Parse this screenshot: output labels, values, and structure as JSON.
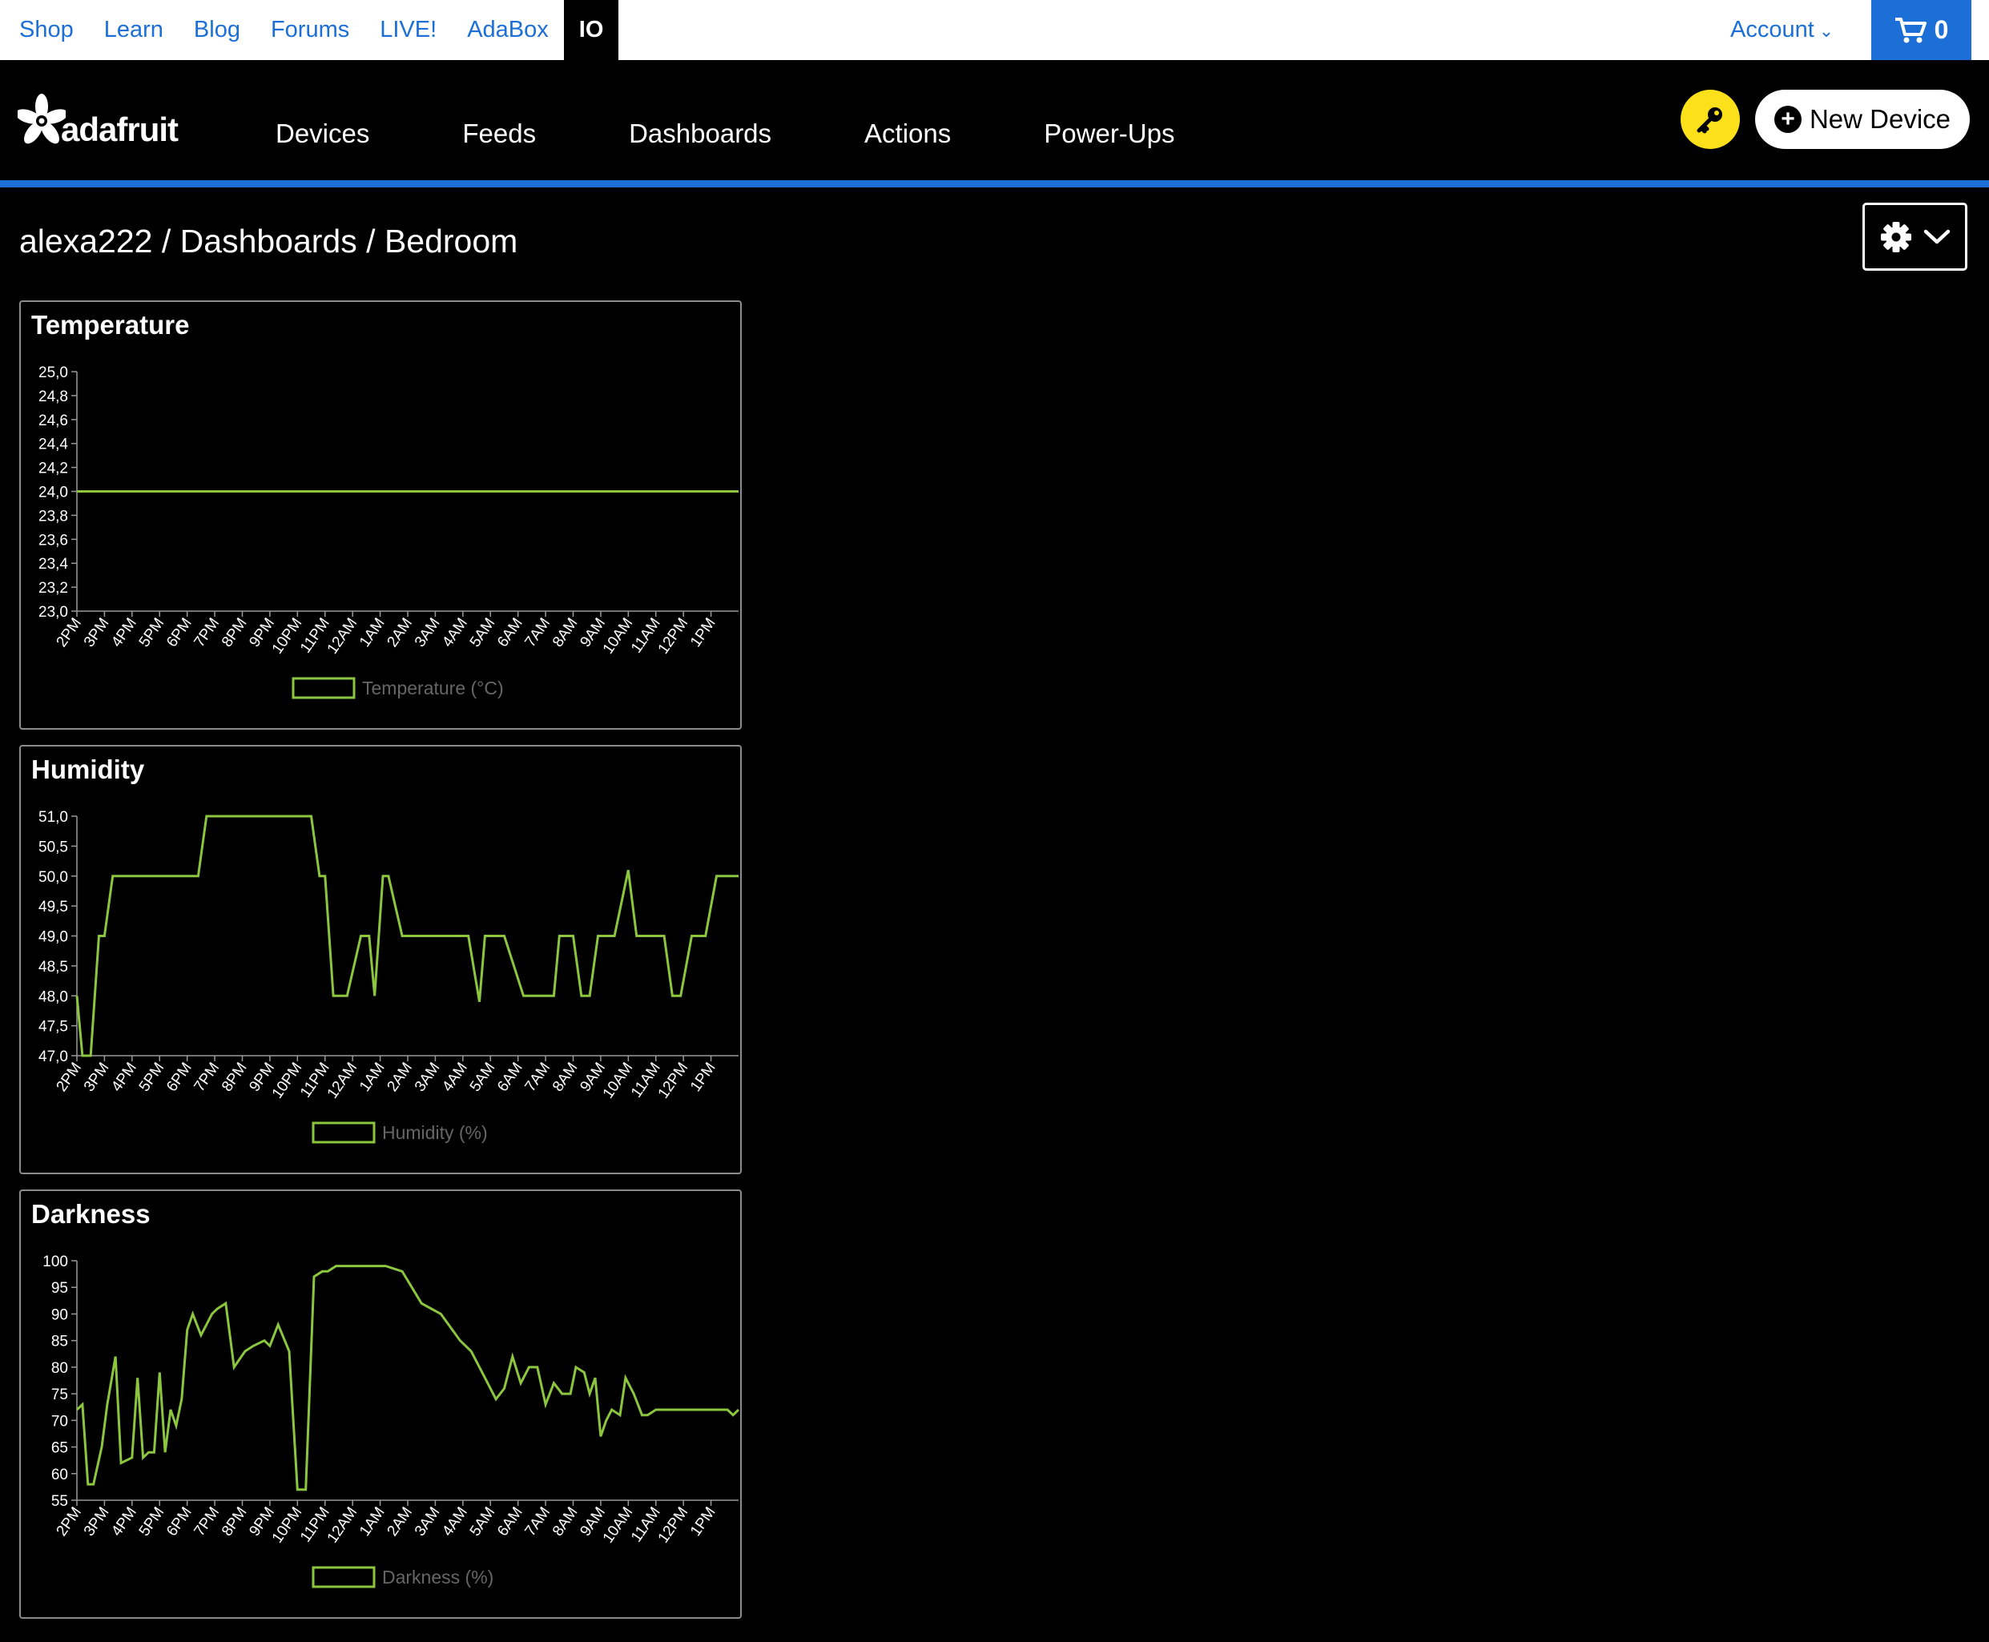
{
  "topbar": {
    "links": [
      "Shop",
      "Learn",
      "Blog",
      "Forums",
      "LIVE!",
      "AdaBox",
      "IO"
    ],
    "active": "IO",
    "account_label": "Account",
    "cart_count": "0"
  },
  "nav": {
    "logo_text": "adafruit",
    "links": [
      "Devices",
      "Feeds",
      "Dashboards",
      "Actions",
      "Power-Ups"
    ],
    "new_device_label": "New Device"
  },
  "breadcrumb": {
    "user": "alexa222",
    "section": "Dashboards",
    "page": "Bedroom",
    "separator": "/"
  },
  "colors": {
    "accent_blue": "#1c6fd6",
    "key_yellow": "#fce01a",
    "series_green": "#8cc63f",
    "legend_text": "#666666"
  },
  "chart_data": [
    {
      "type": "line",
      "title": "Temperature",
      "x_ticks": [
        "2PM",
        "3PM",
        "4PM",
        "5PM",
        "6PM",
        "7PM",
        "8PM",
        "9PM",
        "10PM",
        "11PM",
        "12AM",
        "1AM",
        "2AM",
        "3AM",
        "4AM",
        "5AM",
        "6AM",
        "7AM",
        "8AM",
        "9AM",
        "10AM",
        "11AM",
        "12PM",
        "1PM"
      ],
      "y_ticks": [
        "25,0",
        "24,8",
        "24,6",
        "24,4",
        "24,2",
        "24,0",
        "23,8",
        "23,6",
        "23,4",
        "23,2",
        "23,0"
      ],
      "ylim": [
        23,
        25
      ],
      "xlim": [
        0,
        24
      ],
      "series": [
        {
          "name": "Temperature (°C)",
          "x": [
            0,
            24
          ],
          "y": [
            24.0,
            24.0
          ]
        }
      ]
    },
    {
      "type": "line",
      "title": "Humidity",
      "x_ticks": [
        "2PM",
        "3PM",
        "4PM",
        "5PM",
        "6PM",
        "7PM",
        "8PM",
        "9PM",
        "10PM",
        "11PM",
        "12AM",
        "1AM",
        "2AM",
        "3AM",
        "4AM",
        "5AM",
        "6AM",
        "7AM",
        "8AM",
        "9AM",
        "10AM",
        "11AM",
        "12PM",
        "1PM"
      ],
      "y_ticks": [
        "51,0",
        "50,5",
        "50,0",
        "49,5",
        "49,0",
        "48,5",
        "48,0",
        "47,5",
        "47,0"
      ],
      "ylim": [
        47,
        51
      ],
      "xlim": [
        0,
        24
      ],
      "series": [
        {
          "name": "Humidity (%)",
          "x": [
            0,
            0.2,
            0.5,
            0.8,
            1.0,
            1.3,
            1.7,
            2.5,
            3.5,
            4.4,
            4.7,
            5.3,
            6.3,
            7.5,
            8.5,
            8.8,
            9.0,
            9.3,
            9.8,
            10.3,
            10.6,
            10.8,
            11.1,
            11.3,
            11.8,
            12.5,
            13.5,
            14.2,
            14.6,
            14.8,
            15.5,
            16.2,
            17.3,
            17.5,
            18.0,
            18.3,
            18.6,
            18.9,
            19.5,
            20.0,
            20.3,
            20.6,
            21.3,
            21.6,
            21.9,
            22.3,
            22.8,
            23.2,
            23.6,
            24.0
          ],
          "y": [
            48,
            47,
            47,
            49,
            49,
            50,
            50,
            50,
            50,
            50,
            51,
            51,
            51,
            51,
            51,
            50,
            50,
            48,
            48,
            49,
            49,
            48,
            50,
            50,
            49,
            49,
            49,
            49,
            47.9,
            49,
            49,
            48,
            48,
            49,
            49,
            48,
            48,
            49,
            49,
            50.1,
            49,
            49,
            49,
            48,
            48,
            49,
            49,
            50,
            50,
            50
          ]
        }
      ]
    },
    {
      "type": "line",
      "title": "Darkness",
      "x_ticks": [
        "2PM",
        "3PM",
        "4PM",
        "5PM",
        "6PM",
        "7PM",
        "8PM",
        "9PM",
        "10PM",
        "11PM",
        "12AM",
        "1AM",
        "2AM",
        "3AM",
        "4AM",
        "5AM",
        "6AM",
        "7AM",
        "8AM",
        "9AM",
        "10AM",
        "11AM",
        "12PM",
        "1PM"
      ],
      "y_ticks": [
        "100",
        "95",
        "90",
        "85",
        "80",
        "75",
        "70",
        "65",
        "60",
        "55"
      ],
      "ylim": [
        55,
        100
      ],
      "xlim": [
        0,
        24
      ],
      "series": [
        {
          "name": "Darkness (%)",
          "x": [
            0,
            0.2,
            0.4,
            0.6,
            0.9,
            1.1,
            1.4,
            1.6,
            2.0,
            2.2,
            2.4,
            2.6,
            2.8,
            3.0,
            3.2,
            3.4,
            3.6,
            3.8,
            4.0,
            4.2,
            4.5,
            4.7,
            4.9,
            5.1,
            5.4,
            5.7,
            6.1,
            6.4,
            6.8,
            7.0,
            7.3,
            7.7,
            8.0,
            8.3,
            8.6,
            8.9,
            9.1,
            9.4,
            9.6,
            9.8,
            10.0,
            10.3,
            10.6,
            10.9,
            11.2,
            11.8,
            12.5,
            13.2,
            13.9,
            14.3,
            14.8,
            15.2,
            15.5,
            15.8,
            16.1,
            16.4,
            16.7,
            17.0,
            17.3,
            17.6,
            17.9,
            18.1,
            18.4,
            18.6,
            18.8,
            19.0,
            19.2,
            19.4,
            19.7,
            19.9,
            20.2,
            20.5,
            20.7,
            21.0,
            21.3,
            21.5,
            21.7,
            21.9,
            22.2,
            22.5,
            22.8,
            23.0,
            23.3,
            23.6,
            23.8,
            24.0
          ],
          "y": [
            72,
            73,
            58,
            58,
            65,
            73,
            82,
            62,
            63,
            78,
            63,
            64,
            64,
            79,
            64,
            72,
            69,
            74,
            87,
            90,
            86,
            88,
            90,
            91,
            92,
            80,
            83,
            84,
            85,
            84,
            88,
            83,
            57,
            57,
            97,
            98,
            98,
            99,
            99,
            99,
            99,
            99,
            99,
            99,
            99,
            98,
            92,
            90,
            85,
            83,
            78,
            74,
            76,
            82,
            77,
            80,
            80,
            73,
            77,
            75,
            75,
            80,
            79,
            75,
            78,
            67,
            70,
            72,
            71,
            78,
            75,
            71,
            71,
            72,
            72,
            72,
            72,
            72,
            72,
            72,
            72,
            72,
            72,
            72,
            71,
            72
          ]
        }
      ]
    }
  ]
}
